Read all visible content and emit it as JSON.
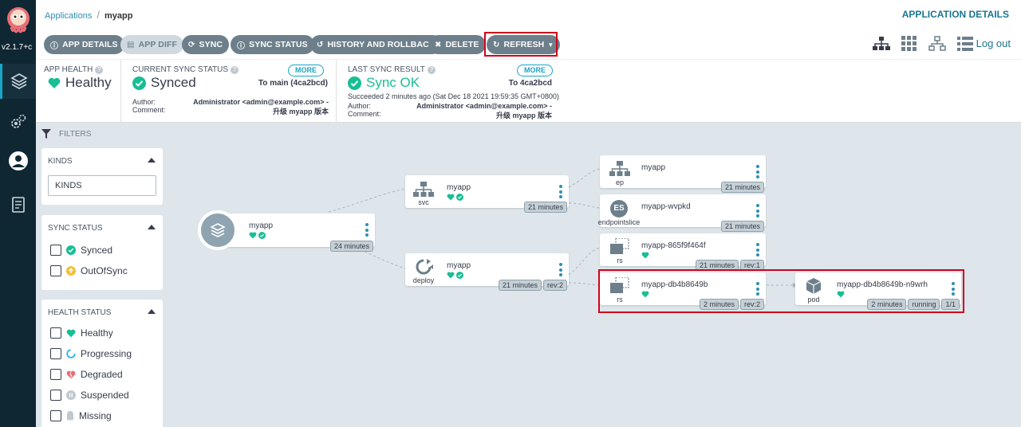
{
  "nav": {
    "version": "v2.1.7+c"
  },
  "breadcrumb": {
    "parent": "Applications",
    "current": "myapp"
  },
  "page_title": "APPLICATION DETAILS",
  "toolbar": {
    "app_details": "APP DETAILS",
    "app_diff": "APP DIFF",
    "sync": "SYNC",
    "sync_status": "SYNC STATUS",
    "history": "HISTORY AND ROLLBACK",
    "delete": "DELETE",
    "refresh": "REFRESH",
    "logout": "Log out"
  },
  "status": {
    "app_health_label": "APP HEALTH",
    "app_health_value": "Healthy",
    "sync_label": "CURRENT SYNC STATUS",
    "sync_value": "Synced",
    "sync_more": "MORE",
    "sync_target": "To main (4ca2bcd)",
    "author_label": "Author:",
    "comment_label": "Comment:",
    "author_value": "Administrator <admin@example.com> -",
    "comment_value": "升级 myapp 版本",
    "last_label": "LAST SYNC RESULT",
    "last_value": "Sync OK",
    "last_more": "MORE",
    "last_target": "To 4ca2bcd",
    "last_succeeded": "Succeeded 2 minutes ago (Sat Dec 18 2021 19:59:35 GMT+0800)",
    "last_author_value": "Administrator <admin@example.com> -",
    "last_comment_value": "升级 myapp 版本"
  },
  "filters": {
    "header": "FILTERS",
    "kinds_title": "KINDS",
    "kinds_placeholder": "KINDS",
    "sync_title": "SYNC STATUS",
    "sync_options": [
      "Synced",
      "OutOfSync"
    ],
    "health_title": "HEALTH STATUS",
    "health_options": [
      "Healthy",
      "Progressing",
      "Degraded",
      "Suspended",
      "Missing"
    ]
  },
  "colors": {
    "healthy": "#18be94",
    "accent": "#19a5c5",
    "button": "#6d7f8b",
    "highlight": "#d0021b",
    "outofsync": "#f4c030",
    "degraded": "#e96d76"
  },
  "graph": {
    "root": {
      "name": "myapp",
      "age": "24 minutes"
    },
    "svc": {
      "name": "myapp",
      "kind": "svc",
      "age": "21 minutes"
    },
    "deploy": {
      "name": "myapp",
      "kind": "deploy",
      "age": "21 minutes",
      "rev": "rev:2"
    },
    "ep": {
      "name": "myapp",
      "kind": "ep",
      "age": "21 minutes"
    },
    "endpointslice": {
      "name": "myapp-wvpkd",
      "kind": "endpointslice",
      "icon_text": "ES",
      "age": "21 minutes"
    },
    "rs_old": {
      "name": "myapp-865f9f464f",
      "kind": "rs",
      "age": "21 minutes",
      "rev": "rev:1"
    },
    "rs_new": {
      "name": "myapp-db4b8649b",
      "kind": "rs",
      "age": "2 minutes",
      "rev": "rev:2"
    },
    "pod": {
      "name": "myapp-db4b8649b-n9wrh",
      "kind": "pod",
      "age": "2 minutes",
      "state": "running",
      "ready": "1/1"
    }
  }
}
